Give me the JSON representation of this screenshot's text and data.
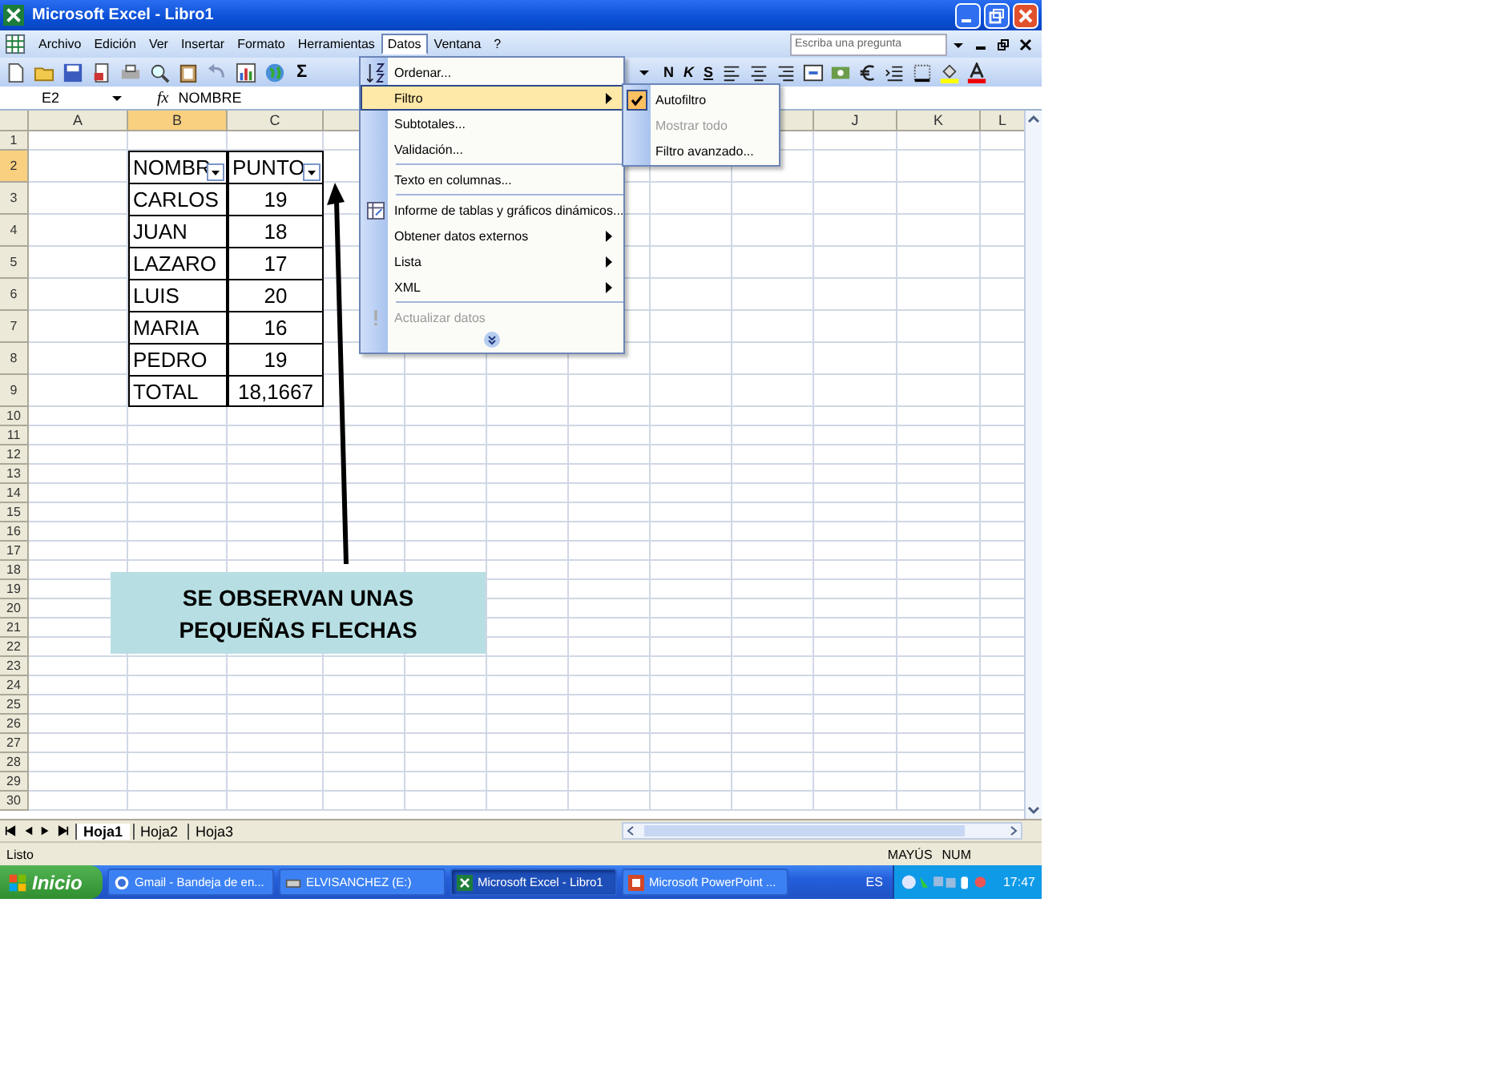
{
  "window": {
    "title": "Microsoft Excel - Libro1"
  },
  "menu_bar": {
    "items": [
      {
        "label": "Archivo",
        "selected": false
      },
      {
        "label": "Edición",
        "selected": false
      },
      {
        "label": "Ver",
        "selected": false
      },
      {
        "label": "Insertar",
        "selected": false
      },
      {
        "label": "Formato",
        "selected": false
      },
      {
        "label": "Herramientas",
        "selected": false
      },
      {
        "label": "Datos",
        "selected": true
      },
      {
        "label": "Ventana",
        "selected": false
      },
      {
        "label": "?",
        "selected": false
      }
    ],
    "help_search": {
      "placeholder": "Escriba una pregunta"
    }
  },
  "toolbar": {
    "sum_label": "Σ",
    "format_buttons": [
      "N",
      "K",
      "S"
    ]
  },
  "formula_bar": {
    "cell_ref": "E2",
    "fx": "fx",
    "value": "NOMBRE"
  },
  "columns": {
    "left": [
      {
        "label": "A",
        "selected": false
      },
      {
        "label": "B",
        "selected": true
      },
      {
        "label": "C",
        "selected": false
      }
    ],
    "right": [
      {
        "label": "J",
        "selected": false
      },
      {
        "label": "K",
        "selected": false
      },
      {
        "label": "L",
        "selected": false
      }
    ]
  },
  "rows": [
    {
      "label": "1",
      "selected": false
    },
    {
      "label": "2",
      "selected": true
    },
    {
      "label": "3",
      "selected": false
    },
    {
      "label": "4",
      "selected": false
    },
    {
      "label": "5",
      "selected": false
    },
    {
      "label": "6",
      "selected": false
    },
    {
      "label": "7",
      "selected": false
    },
    {
      "label": "8",
      "selected": false
    },
    {
      "label": "9",
      "selected": false
    },
    {
      "label": "10",
      "selected": false
    },
    {
      "label": "11",
      "selected": false
    },
    {
      "label": "12",
      "selected": false
    },
    {
      "label": "13",
      "selected": false
    },
    {
      "label": "14",
      "selected": false
    },
    {
      "label": "15",
      "selected": false
    },
    {
      "label": "16",
      "selected": false
    },
    {
      "label": "17",
      "selected": false
    },
    {
      "label": "18",
      "selected": false
    },
    {
      "label": "19",
      "selected": false
    },
    {
      "label": "20",
      "selected": false
    },
    {
      "label": "21",
      "selected": false
    },
    {
      "label": "22",
      "selected": false
    },
    {
      "label": "23",
      "selected": false
    },
    {
      "label": "24",
      "selected": false
    },
    {
      "label": "25",
      "selected": false
    },
    {
      "label": "26",
      "selected": false
    },
    {
      "label": "27",
      "selected": false
    },
    {
      "label": "28",
      "selected": false
    },
    {
      "label": "29",
      "selected": false
    },
    {
      "label": "30",
      "selected": false
    }
  ],
  "table": {
    "header": [
      {
        "text": "NOMBR",
        "filter": true
      },
      {
        "text": "PUNTO",
        "filter": true
      }
    ],
    "rows": [
      [
        "CARLOS",
        "19"
      ],
      [
        "JUAN",
        "18"
      ],
      [
        "LAZARO",
        "17"
      ],
      [
        "LUIS",
        "20"
      ],
      [
        "MARIA",
        "16"
      ],
      [
        "PEDRO",
        "19"
      ],
      [
        "TOTAL",
        "18,1667"
      ]
    ]
  },
  "data_menu": {
    "items": [
      {
        "kind": "item",
        "label": "Ordenar...",
        "submenu": false,
        "selected": false,
        "disabled": false
      },
      {
        "kind": "item",
        "label": "Filtro",
        "submenu": true,
        "selected": true,
        "disabled": false
      },
      {
        "kind": "item",
        "label": "Subtotales...",
        "submenu": false,
        "selected": false,
        "disabled": false
      },
      {
        "kind": "item",
        "label": "Validación...",
        "submenu": false,
        "selected": false,
        "disabled": false
      },
      {
        "kind": "separator"
      },
      {
        "kind": "item",
        "label": "Texto en columnas...",
        "submenu": false,
        "selected": false,
        "disabled": false
      },
      {
        "kind": "separator"
      },
      {
        "kind": "item",
        "label": "Informe de tablas y gráficos dinámicos...",
        "submenu": false,
        "selected": false,
        "disabled": false
      },
      {
        "kind": "item",
        "label": "Obtener datos externos",
        "submenu": true,
        "selected": false,
        "disabled": false
      },
      {
        "kind": "item",
        "label": "Lista",
        "submenu": true,
        "selected": false,
        "disabled": false
      },
      {
        "kind": "item",
        "label": "XML",
        "submenu": true,
        "selected": false,
        "disabled": false
      },
      {
        "kind": "separator"
      },
      {
        "kind": "item",
        "label": "Actualizar datos",
        "submenu": false,
        "selected": false,
        "disabled": true
      },
      {
        "kind": "expand"
      }
    ]
  },
  "filter_submenu": {
    "items": [
      {
        "label": "Autofiltro",
        "checked": true,
        "disabled": false
      },
      {
        "label": "Mostrar todo",
        "checked": false,
        "disabled": true
      },
      {
        "label": "Filtro avanzado...",
        "checked": false,
        "disabled": false
      }
    ]
  },
  "callout": {
    "text": "SE OBSERVAN UNAS PEQUEÑAS FLECHAS"
  },
  "sheet_tabs": [
    {
      "label": "Hoja1",
      "selected": true
    },
    {
      "label": "Hoja2",
      "selected": false
    },
    {
      "label": "Hoja3",
      "selected": false
    }
  ],
  "status_bar": {
    "text": "Listo",
    "indicators": [
      "MAYÚS",
      "NUM"
    ]
  },
  "taskbar": {
    "start": "Inicio",
    "tasks": [
      {
        "label": "Gmail - Bandeja de en...",
        "selected": false
      },
      {
        "label": "ELVISANCHEZ (E:)",
        "selected": false
      },
      {
        "label": "Microsoft Excel - Libro1",
        "selected": true
      },
      {
        "label": "Microsoft PowerPoint ...",
        "selected": false
      }
    ],
    "language": "ES",
    "clock": "17:47"
  }
}
